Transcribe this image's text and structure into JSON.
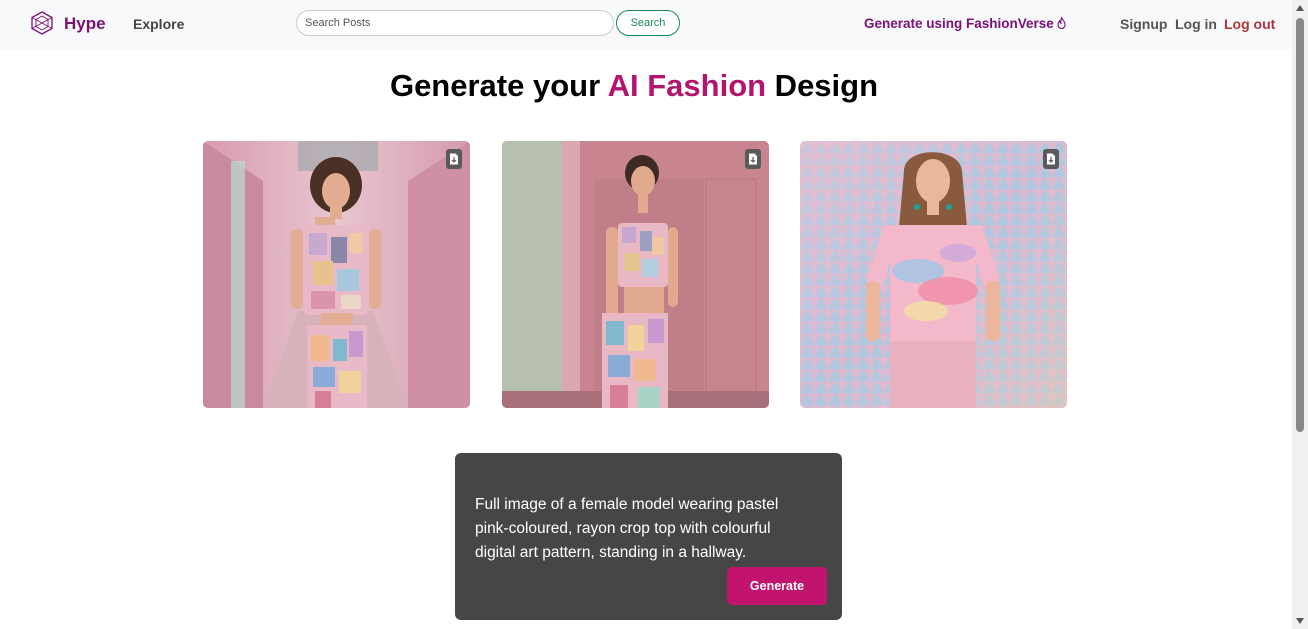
{
  "navbar": {
    "brand": "Hype",
    "explore_label": "Explore",
    "search_placeholder": "Search Posts",
    "search_value": "",
    "search_button_label": "Search",
    "fashionverse_link_label": "Generate using FashionVerse",
    "signup_label": "Signup",
    "login_label": "Log in",
    "logout_label": "Log out"
  },
  "main": {
    "title_part1": "Generate your ",
    "title_accent": "AI Fashion",
    "title_part2": " Design",
    "images": [
      {
        "icon": "download-file-icon"
      },
      {
        "icon": "download-file-icon"
      },
      {
        "icon": "download-file-icon"
      }
    ],
    "prompt_text": "Full image of a female model wearing pastel pink-coloured, rayon crop top with colourful digital art pattern, standing in a hallway.",
    "generate_label": "Generate"
  },
  "colors": {
    "brand": "#7b1078",
    "accent": "#b3156e",
    "generate_button": "#c2136e",
    "search_button": "#198754",
    "logout": "#b0343c",
    "prompt_box": "#464646"
  }
}
